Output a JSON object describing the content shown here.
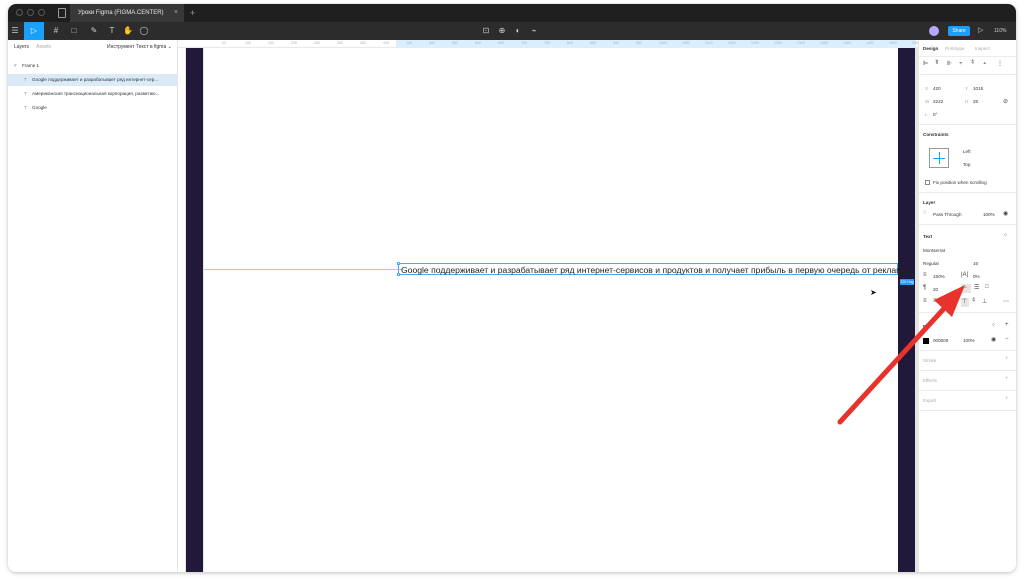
{
  "tab": {
    "title": "Уроки Figma (FIGMA.CENTER)",
    "close": "×",
    "add": "+"
  },
  "toolbar": {
    "menu_icon": "☰",
    "move_icon": "▷",
    "frame_icon": "#",
    "shape_icon": "□",
    "pen_icon": "✎",
    "text_icon": "T",
    "hand_icon": "✋",
    "comment_icon": "◯",
    "share_label": "Share",
    "play_icon": "▷",
    "zoom": "110%"
  },
  "left_panel": {
    "tabs": [
      "Layers",
      "Assets"
    ],
    "page": "Инструмент Текст в figma",
    "layers": [
      {
        "icon": "#",
        "name": "Frame 1"
      },
      {
        "icon": "T",
        "name": "Google поддерживает и разрабатывает ряд интернет-сер..."
      },
      {
        "icon": "T",
        "name": "Американская транснациональная корпорация, развитию..."
      },
      {
        "icon": "T",
        "name": "Google"
      }
    ]
  },
  "canvas": {
    "ruler_ticks": [
      "60",
      "100",
      "150",
      "200",
      "250",
      "300",
      "350",
      "400",
      "420",
      "500",
      "550",
      "600",
      "650",
      "700",
      "750",
      "800",
      "850",
      "900",
      "950",
      "1000",
      "1050",
      "1100",
      "1150",
      "1200",
      "1250",
      "1300",
      "1350",
      "1400",
      "1450",
      "1500",
      "1550"
    ],
    "text_content": "Google поддерживает и разрабатывает ряд интернет-сервисов и продуктов и получает прибыль в первую очередь от рекламы.",
    "badge": "220 Hug",
    "help": "?"
  },
  "right_panel": {
    "tabs": [
      "Design",
      "Prototype",
      "Inspect"
    ],
    "x_label": "X",
    "x_value": "420",
    "y_label": "Y",
    "y_value": "1015",
    "w_label": "W",
    "w_value": "2222",
    "h_label": "H",
    "h_value": "25",
    "r_label": "L",
    "r_value": "0°",
    "constraints_title": "Constraints",
    "constraint_h": "Left",
    "constraint_v": "Top",
    "fix_position": "Fix position when scrolling",
    "layer_title": "Layer",
    "blend": "Pass Through",
    "layer_opacity": "100%",
    "text_title": "Text",
    "font_family": "Montserrat",
    "font_weight": "Regular",
    "font_size": "16",
    "line_height": "150%",
    "letter_spacing": "0%",
    "paragraph_spacing": "20",
    "fill_title": "Fill",
    "fill_hex": "000000",
    "fill_opacity": "100%",
    "stroke_title": "Stroke",
    "effects_title": "Effects",
    "export_title": "Export",
    "add_icon": "+",
    "colors": {
      "accent": "#18a0fb",
      "frame_dark": "#22183a",
      "arrow": "#e8322c"
    }
  }
}
